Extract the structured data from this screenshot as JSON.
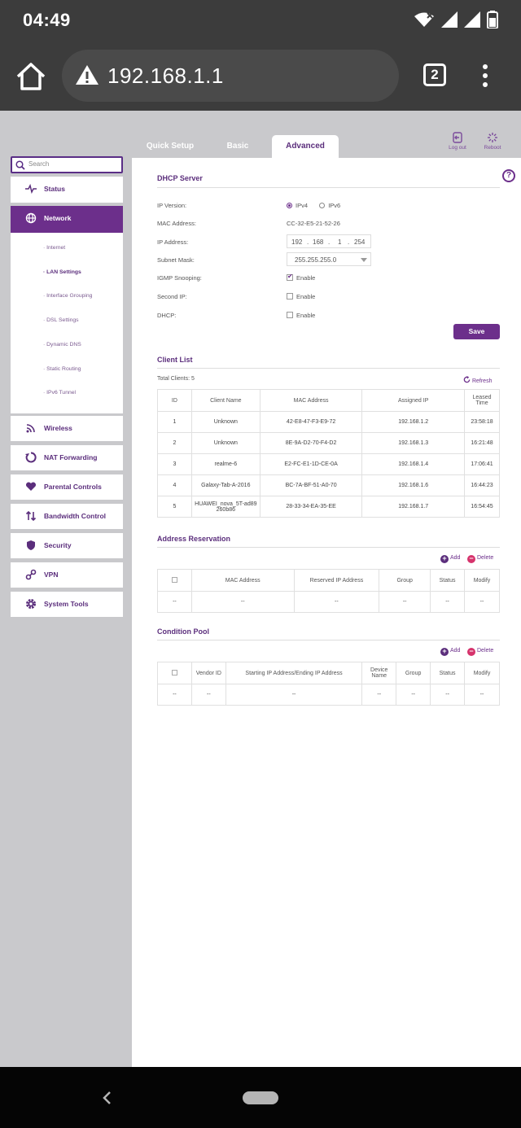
{
  "status_bar": {
    "time": "04:49"
  },
  "browser": {
    "url": "192.168.1.1",
    "tab_count": "2"
  },
  "top_tabs": [
    "Quick Setup",
    "Basic",
    "Advanced"
  ],
  "tools": {
    "logout": "Log out",
    "reboot": "Reboot"
  },
  "sidebar": {
    "search_placeholder": "Search",
    "items": [
      "Status",
      "Network",
      "Wireless",
      "NAT Forwarding",
      "Parental Controls",
      "Bandwidth Control",
      "Security",
      "VPN",
      "System Tools"
    ],
    "network_sub": [
      "· Internet",
      "· LAN Settings",
      "· Interface Grouping",
      "· DSL Settings",
      "· Dynamic DNS",
      "· Static Routing",
      "· IPv6 Tunnel"
    ]
  },
  "dhcp": {
    "title": "DHCP Server",
    "ip_version_label": "IP Version:",
    "ipv4": "IPv4",
    "ipv6": "IPv6",
    "mac_label": "MAC Address:",
    "mac_value": "CC-32-E5-21-52-26",
    "ip_label": "IP Address:",
    "ip": [
      "192",
      "168",
      "1",
      "254"
    ],
    "ip_dot": ".",
    "subnet_label": "Subnet Mask:",
    "subnet_value": "255.255.255.0",
    "igmp_label": "IGMP Snooping:",
    "second_ip_label": "Second IP:",
    "dhcp_label": "DHCP:",
    "enable": "Enable",
    "save": "Save"
  },
  "client_list": {
    "title": "Client List",
    "total": "Total Clients: 5",
    "refresh": "Refresh",
    "headers": [
      "ID",
      "Client Name",
      "MAC Address",
      "Assigned IP",
      "Leased Time"
    ],
    "rows": [
      [
        "1",
        "Unknown",
        "42-E8-47-F3-E9-72",
        "192.168.1.2",
        "23:58:18"
      ],
      [
        "2",
        "Unknown",
        "8E-9A-D2-70-F4-D2",
        "192.168.1.3",
        "16:21:48"
      ],
      [
        "3",
        "realme-6",
        "E2-FC-E1-1D-CE-0A",
        "192.168.1.4",
        "17:06:41"
      ],
      [
        "4",
        "Galaxy-Tab-A-2016",
        "BC-7A-BF-51-A0-70",
        "192.168.1.6",
        "16:44:23"
      ],
      [
        "5",
        "HUAWEI_nova_5T-ad89 260b86",
        "28-33-34-EA-35-EE",
        "192.168.1.7",
        "16:54:45"
      ]
    ]
  },
  "reservation": {
    "title": "Address Reservation",
    "add": "Add",
    "delete": "Delete",
    "headers": [
      "MAC Address",
      "Reserved IP Address",
      "Group",
      "Status",
      "Modify"
    ],
    "empty": "--"
  },
  "pool": {
    "title": "Condition Pool",
    "add": "Add",
    "delete": "Delete",
    "headers": [
      "Vendor ID",
      "Starting IP Address/Ending IP Address",
      "Device Name",
      "Group",
      "Status",
      "Modify"
    ],
    "empty": "--"
  },
  "colors": {
    "accent": "#6c2f8b",
    "delete": "#d6336c",
    "chrome": "#3c3c3c"
  }
}
